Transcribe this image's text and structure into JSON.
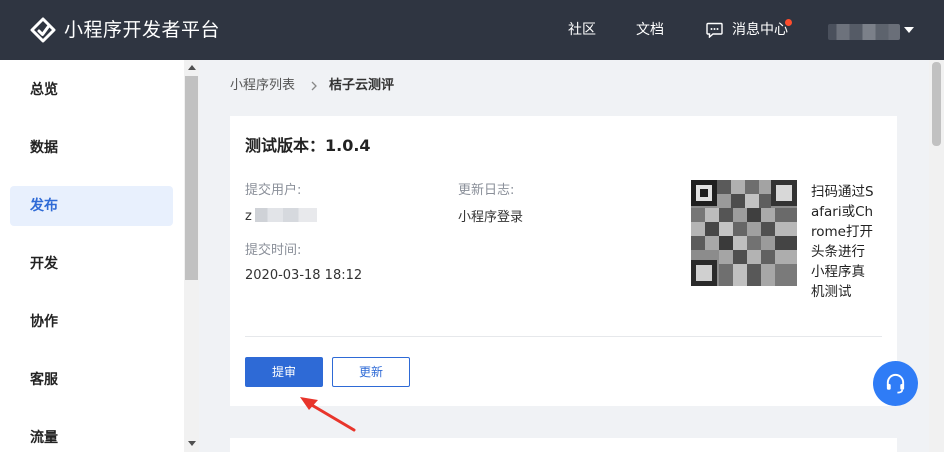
{
  "header": {
    "brand": "小程序开发者平台",
    "nav": [
      "社区",
      "文档",
      "消息中心"
    ]
  },
  "sidebar": {
    "items": [
      {
        "label": "总览",
        "active": false
      },
      {
        "label": "数据",
        "active": false
      },
      {
        "label": "发布",
        "active": true
      },
      {
        "label": "开发",
        "active": false
      },
      {
        "label": "协作",
        "active": false
      },
      {
        "label": "客服",
        "active": false
      },
      {
        "label": "流量",
        "active": false
      }
    ]
  },
  "breadcrumb": [
    "小程序列表",
    "桔子云测评"
  ],
  "card": {
    "title": "测试版本：1.0.4",
    "submit_user_label": "提交用户:",
    "submit_user_value": "z",
    "changelog_label": "更新日志:",
    "changelog_value": "小程序登录",
    "submit_time_label": "提交时间:",
    "submit_time_value": "2020-03-18 18:12",
    "qr_hint": "扫码通过Safari或Chrome打开头条进行小程序真机测试",
    "btn_submit_review": "提审",
    "btn_update": "更新"
  },
  "colors": {
    "accent": "#2e6ad6",
    "topbar": "#2f3541",
    "fab": "#2f7cf6",
    "annotation_arrow": "#e8352b"
  }
}
